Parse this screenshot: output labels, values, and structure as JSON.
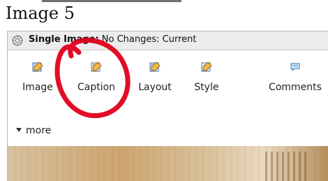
{
  "figure": {
    "title": "Image 5"
  },
  "panel": {
    "header": {
      "label_bold": "Single Image:",
      "label_rest": " No Changes: Current"
    },
    "tools": [
      {
        "label": "Image",
        "icon": "edit-image-icon"
      },
      {
        "label": "Caption",
        "icon": "caption-icon"
      },
      {
        "label": "Layout",
        "icon": "layout-icon"
      },
      {
        "label": "Style",
        "icon": "style-icon"
      },
      {
        "label": "Comments",
        "icon": "comments-icon"
      }
    ],
    "more_label": "more"
  },
  "colors": {
    "annotation_red": "#e0001a",
    "panel_header_bg": "#ececec",
    "panel_border": "#b9b9b9"
  }
}
